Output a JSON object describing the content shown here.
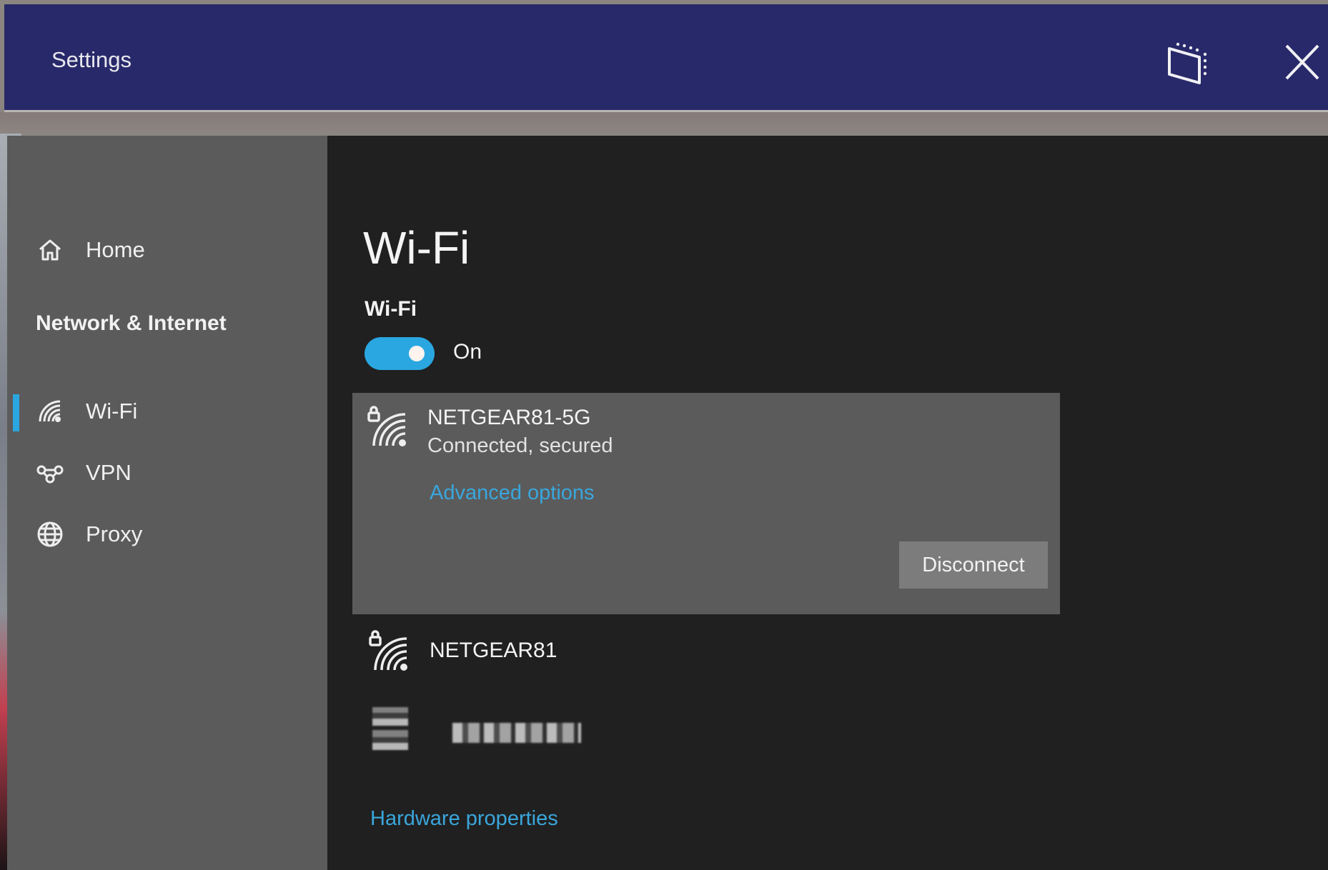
{
  "window": {
    "title": "Settings",
    "snap_button_icon": "snap-window-icon",
    "close_button_icon": "close-icon"
  },
  "sidebar": {
    "home": {
      "label": "Home",
      "icon": "home-icon"
    },
    "section_title": "Network & Internet",
    "items": [
      {
        "label": "Wi-Fi",
        "icon": "wifi-icon",
        "active": true
      },
      {
        "label": "VPN",
        "icon": "vpn-icon",
        "active": false
      },
      {
        "label": "Proxy",
        "icon": "globe-icon",
        "active": false
      }
    ]
  },
  "main": {
    "page_title": "Wi-Fi",
    "toggle": {
      "label": "Wi-Fi",
      "state_label": "On",
      "on": true
    },
    "networks": [
      {
        "name": "NETGEAR81-5G",
        "status": "Connected, secured",
        "secured": true,
        "expanded": true,
        "advanced_link": "Advanced options",
        "action_button": "Disconnect"
      },
      {
        "name": "NETGEAR81",
        "secured": true,
        "expanded": false
      },
      {
        "name": "[redacted]",
        "redacted": true,
        "expanded": false
      }
    ],
    "hardware_link": "Hardware properties"
  },
  "colors": {
    "titlebar": "#28296a",
    "accent": "#2aa7e0",
    "link": "#3aa6dc",
    "sidebar_bg": "#5b5b5b",
    "main_bg": "#202020"
  }
}
